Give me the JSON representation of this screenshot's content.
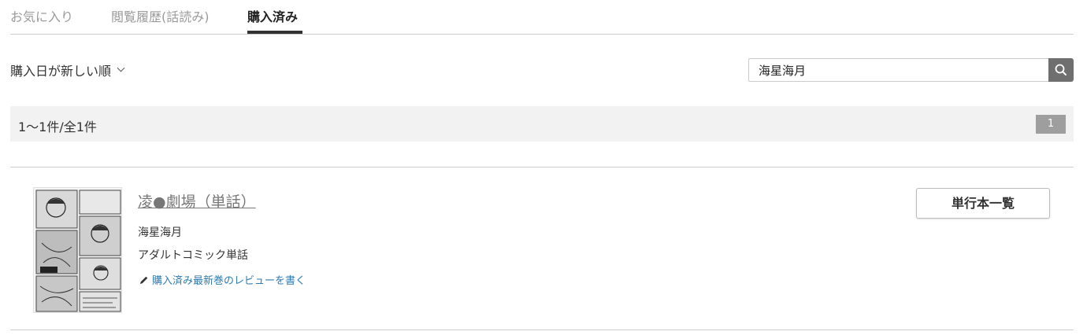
{
  "tabs": [
    {
      "label": "お気に入り",
      "active": false
    },
    {
      "label": "閲覧履歴(話読み)",
      "active": false
    },
    {
      "label": "購入済み",
      "active": true
    }
  ],
  "sort": {
    "label": "購入日が新しい順"
  },
  "search": {
    "value": "海星海月",
    "icon": "search-icon"
  },
  "results": {
    "count_text": "1〜1件/全1件",
    "page": "1"
  },
  "item": {
    "title": "凌●劇場（単話）",
    "author": "海星海月",
    "category": "アダルトコミック単話",
    "review_link": "購入済み最新巻のレビューを書く",
    "volume_button": "単行本一覧",
    "cover_icon": "manga-cover-thumbnail"
  },
  "colors": {
    "link": "#2c7bb0",
    "title": "#777777",
    "search_button": "#6f6f6f",
    "page_badge": "#9e9e9e",
    "result_bar": "#f2f2f2"
  }
}
